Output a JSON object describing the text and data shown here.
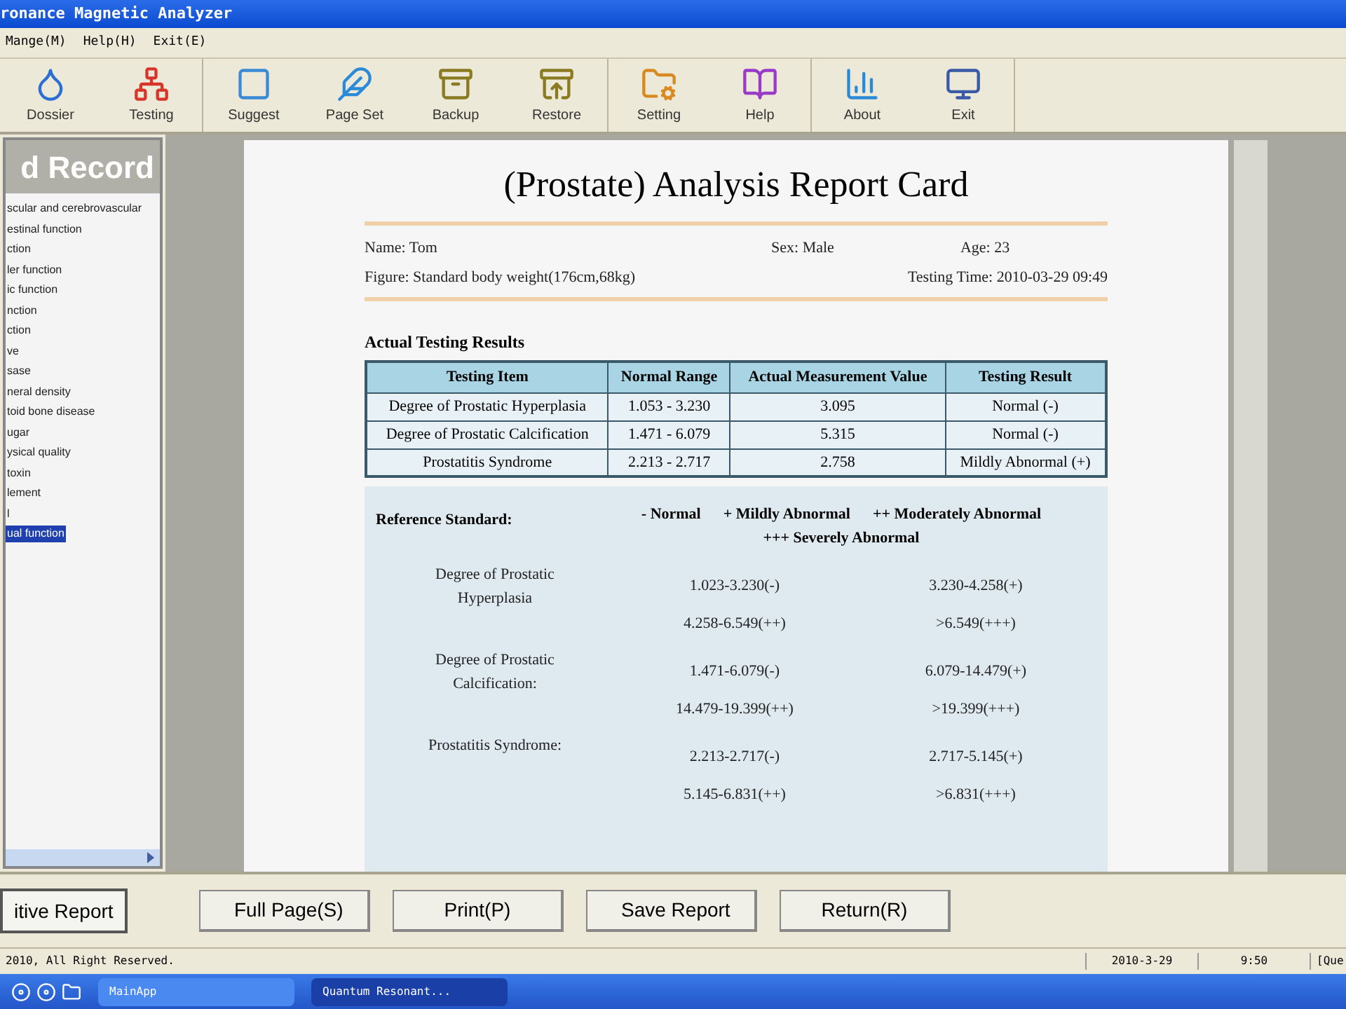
{
  "window": {
    "title": "ronance Magnetic Analyzer"
  },
  "menu": [
    "Mange(M)",
    "Help(H)",
    "Exit(E)"
  ],
  "toolbar_groups": [
    [
      "Dossier",
      "Testing"
    ],
    [
      "Suggest",
      "Page Set",
      "Backup",
      "Restore"
    ],
    [
      "Setting",
      "Help"
    ],
    [
      "About",
      "Exit"
    ]
  ],
  "sidebar": {
    "header": "d Record",
    "items": [
      {
        "label": "scular and cerebrovascular",
        "selected": false
      },
      {
        "label": "estinal function",
        "selected": false
      },
      {
        "label": "ction",
        "selected": false
      },
      {
        "label": "ler function",
        "selected": false
      },
      {
        "label": "ic function",
        "selected": false
      },
      {
        "label": "nction",
        "selected": false
      },
      {
        "label": "ction",
        "selected": false
      },
      {
        "label": "ve",
        "selected": false
      },
      {
        "label": "sase",
        "selected": false
      },
      {
        "label": "neral density",
        "selected": false
      },
      {
        "label": "toid bone disease",
        "selected": false
      },
      {
        "label": "ugar",
        "selected": false
      },
      {
        "label": "ysical quality",
        "selected": false
      },
      {
        "label": "toxin",
        "selected": false
      },
      {
        "label": "lement",
        "selected": false
      },
      {
        "label": "l",
        "selected": false
      },
      {
        "label": "ual function",
        "selected": true
      }
    ],
    "button": "itive Report"
  },
  "report": {
    "title": "(Prostate) Analysis Report Card",
    "name": "Name: Tom",
    "sex": "Sex: Male",
    "age": "Age: 23",
    "figure": "Figure: Standard body weight(176cm,68kg)",
    "time": "Testing Time: 2010-03-29 09:49",
    "results_heading": "Actual Testing Results",
    "columns": [
      "Testing Item",
      "Normal Range",
      "Actual Measurement Value",
      "Testing Result"
    ],
    "rows": [
      [
        "Degree of Prostatic Hyperplasia",
        "1.053 - 3.230",
        "3.095",
        "Normal (-)"
      ],
      [
        "Degree of Prostatic Calcification",
        "1.471 - 6.079",
        "5.315",
        "Normal (-)"
      ],
      [
        "Prostatitis Syndrome",
        "2.213 - 2.717",
        "2.758",
        "Mildly Abnormal (+)"
      ]
    ],
    "reference_label": "Reference Standard:",
    "legend": [
      "- Normal",
      "+ Mildly Abnormal",
      "++ Moderately Abnormal",
      "+++ Severely Abnormal"
    ],
    "reference": [
      {
        "name": "Degree of Prostatic Hyperplasia",
        "ranges": [
          "1.023-3.230(-)",
          "3.230-4.258(+)",
          "4.258-6.549(++)",
          ">6.549(+++)"
        ]
      },
      {
        "name": "Degree of Prostatic Calcification:",
        "ranges": [
          "1.471-6.079(-)",
          "6.079-14.479(+)",
          "14.479-19.399(++)",
          ">19.399(+++)"
        ]
      },
      {
        "name": "Prostatitis Syndrome:",
        "ranges": [
          "2.213-2.717(-)",
          "2.717-5.145(+)",
          "5.145-6.831(++)",
          ">6.831(+++)"
        ]
      }
    ]
  },
  "actions": [
    "Full Page(S)",
    "Print(P)",
    "Save Report",
    "Return(R)"
  ],
  "status_bar": [
    "2010, All Right Reserved.",
    "2010-3-29",
    "9:50",
    "[Que"
  ],
  "taskbar": [
    {
      "label": "MainApp",
      "selected": false
    },
    {
      "label": "Quantum Resonant...",
      "selected": true
    }
  ]
}
